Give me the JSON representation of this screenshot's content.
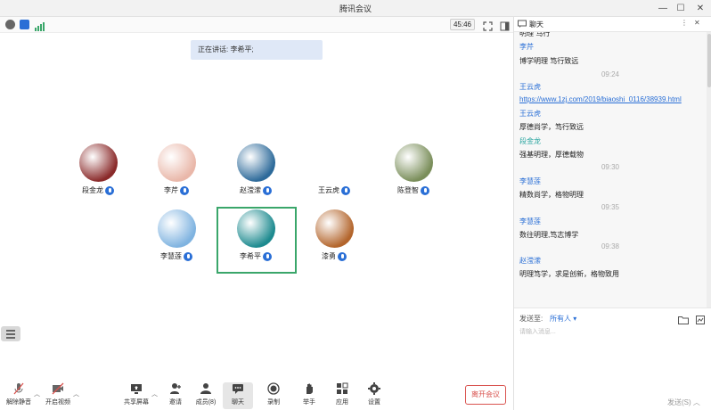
{
  "window": {
    "title": "腾讯会议"
  },
  "status": {
    "timer": "45:46"
  },
  "speaking": {
    "text": "正在讲话: 李希平;"
  },
  "participants": [
    {
      "name": "段金龙",
      "avatar_color": "#8a2a2a"
    },
    {
      "name": "李芹",
      "avatar_color": "#e9b7a9"
    },
    {
      "name": "赵滢潆",
      "avatar_color": "#2d6a9a"
    },
    {
      "name": "王云虎",
      "avatar_color": "#ffffff"
    },
    {
      "name": "陈登智",
      "avatar_color": "#7a8e5a"
    },
    {
      "name": "李慧莲",
      "avatar_color": "#7fb3e0"
    },
    {
      "name": "李希平",
      "avatar_color": "#1d8a8f"
    },
    {
      "name": "漆勇",
      "avatar_color": "#b3652c"
    }
  ],
  "toolbar": {
    "mute": "解除静音",
    "video": "开启视频",
    "share": "共享屏幕",
    "invite": "邀请",
    "members": "成员(8)",
    "chat": "聊天",
    "record": "录制",
    "raise_hand": "举手",
    "apps": "应用",
    "settings": "设置",
    "leave": "离开会议"
  },
  "chat": {
    "title": "聊天",
    "messages": [
      {
        "kind": "text",
        "text": "明理  笃行"
      },
      {
        "kind": "name",
        "text": "李芹"
      },
      {
        "kind": "text",
        "text": "博学明理  笃行致远"
      },
      {
        "kind": "time",
        "text": "09:24"
      },
      {
        "kind": "name",
        "text": "王云虎"
      },
      {
        "kind": "link",
        "text": "https://www.1zj.com/2019/biaoshi_0116/38939.html"
      },
      {
        "kind": "name",
        "text": "王云虎"
      },
      {
        "kind": "text",
        "text": "厚德尚学，笃行致远"
      },
      {
        "kind": "name2",
        "text": "段金龙"
      },
      {
        "kind": "text",
        "text": "强基明理，厚德载物"
      },
      {
        "kind": "time",
        "text": "09:30"
      },
      {
        "kind": "name",
        "text": "李慧莲"
      },
      {
        "kind": "text",
        "text": "精数尚学，格物明理"
      },
      {
        "kind": "time",
        "text": "09:35"
      },
      {
        "kind": "name",
        "text": "李慧莲"
      },
      {
        "kind": "text",
        "text": "数往明理,笃志博学"
      },
      {
        "kind": "time",
        "text": "09:38"
      },
      {
        "kind": "name",
        "text": "赵滢潆"
      },
      {
        "kind": "text",
        "text": "明理笃学，求是创新，格物致用"
      }
    ],
    "send_to_label": "发送至:",
    "send_to_value": "所有人",
    "input_placeholder": "请输入消息...",
    "send_button": "发送(S)"
  },
  "colors": {
    "accent": "#2a6fd6",
    "name_teal": "#2aa5a0",
    "leave_red": "#d9534f",
    "active_green": "#3aa66a"
  }
}
